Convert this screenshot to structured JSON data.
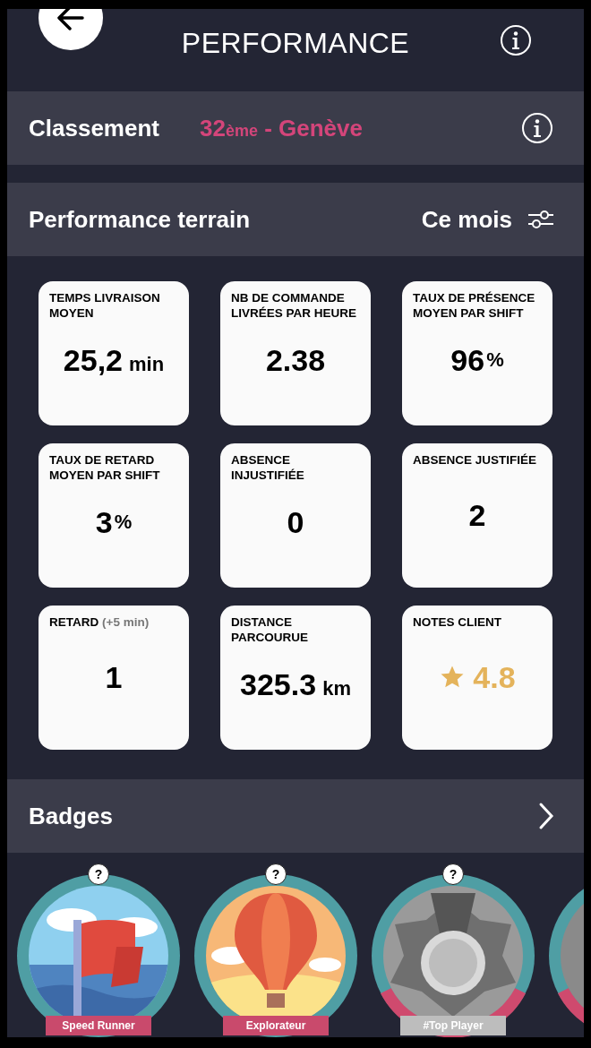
{
  "header": {
    "title": "PERFORMANCE"
  },
  "ranking": {
    "label": "Classement",
    "rank": "32",
    "rank_suffix": "ème",
    "city": "- Genève"
  },
  "performance": {
    "title": "Performance terrain",
    "period": "Ce mois",
    "cards": [
      {
        "kind": "number",
        "label": "TEMPS LIVRAISON MOYEN",
        "value": "25,2",
        "unit": "min"
      },
      {
        "kind": "number",
        "label": "NB DE COMMANDE LIVRÉES PAR HEURE",
        "value": "2.38"
      },
      {
        "kind": "number",
        "label": "TAUX DE PRÉSENCE MOYEN PAR SHIFT",
        "value": "96",
        "unit": "%"
      },
      {
        "kind": "number",
        "label": "TAUX DE RETARD MOYEN PAR SHIFT",
        "value": "3",
        "unit": "%"
      },
      {
        "kind": "number",
        "label": "ABSENCE INJUSTIFIÉE",
        "value": "0"
      },
      {
        "kind": "number",
        "label": "ABSENCE JUSTIFIÉE",
        "value": "2"
      },
      {
        "kind": "number",
        "label": "RETARD",
        "note": "(+5 min)",
        "value": "1"
      },
      {
        "kind": "number",
        "label": "DISTANCE PARCOURUE",
        "value": "325.3",
        "unit": "km"
      },
      {
        "kind": "rating",
        "label": "NOTES CLIENT",
        "value": "4.8"
      }
    ]
  },
  "badges": {
    "title": "Badges",
    "items": [
      {
        "kind": "flag",
        "help": "?",
        "label": "Speed Runner",
        "locked": false
      },
      {
        "kind": "balloon",
        "help": "?",
        "label": "Explorateur",
        "locked": false
      },
      {
        "kind": "medal",
        "help": "?",
        "label": "#Top Player",
        "locked": true
      },
      {
        "locked": true
      }
    ]
  }
}
